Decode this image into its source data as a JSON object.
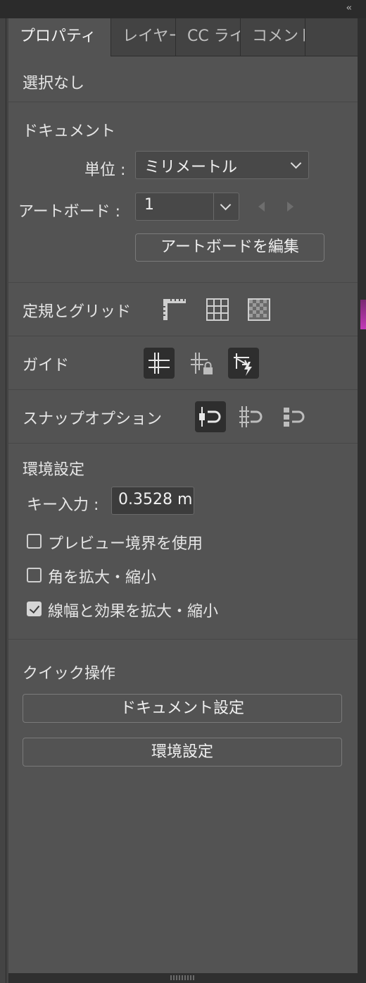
{
  "tabs": [
    {
      "label": "プロパティ",
      "active": true
    },
    {
      "label": "レイヤー"
    },
    {
      "label": "CC ライ"
    },
    {
      "label": "コメント"
    }
  ],
  "selection": {
    "label": "選択なし"
  },
  "document": {
    "heading": "ドキュメント",
    "units_label": "単位 :",
    "units_value": "ミリメートル",
    "artboard_label": "アートボード :",
    "artboard_value": "1",
    "edit_artboards_button": "アートボードを編集"
  },
  "rulers_grids": {
    "label": "定規とグリッド",
    "icons": [
      "ruler-icon",
      "grid-icon",
      "transparency-grid-icon"
    ]
  },
  "guides": {
    "label": "ガイド",
    "icons": [
      "guides-icon",
      "lock-guides-icon",
      "smart-guides-icon"
    ]
  },
  "snap_options": {
    "label": "スナップオプション",
    "icons": [
      "snap-to-point-icon",
      "snap-to-grid-icon",
      "snap-to-pixel-icon"
    ]
  },
  "preferences": {
    "heading": "環境設定",
    "keyboard_increment_label": "キー入力 :",
    "keyboard_increment_value": "0.3528 m",
    "use_preview_bounds": {
      "label": "プレビュー境界を使用",
      "checked": false
    },
    "scale_corners": {
      "label": "角を拡大・縮小",
      "checked": false
    },
    "scale_strokes_effects": {
      "label": "線幅と効果を拡大・縮小",
      "checked": true
    }
  },
  "quick_actions": {
    "heading": "クイック操作",
    "document_setup_button": "ドキュメント設定",
    "preferences_button": "環境設定"
  },
  "colors": {
    "panel": "#535353",
    "tab_bar": "#434343",
    "selected_icon_bg": "#2e2e2e"
  }
}
